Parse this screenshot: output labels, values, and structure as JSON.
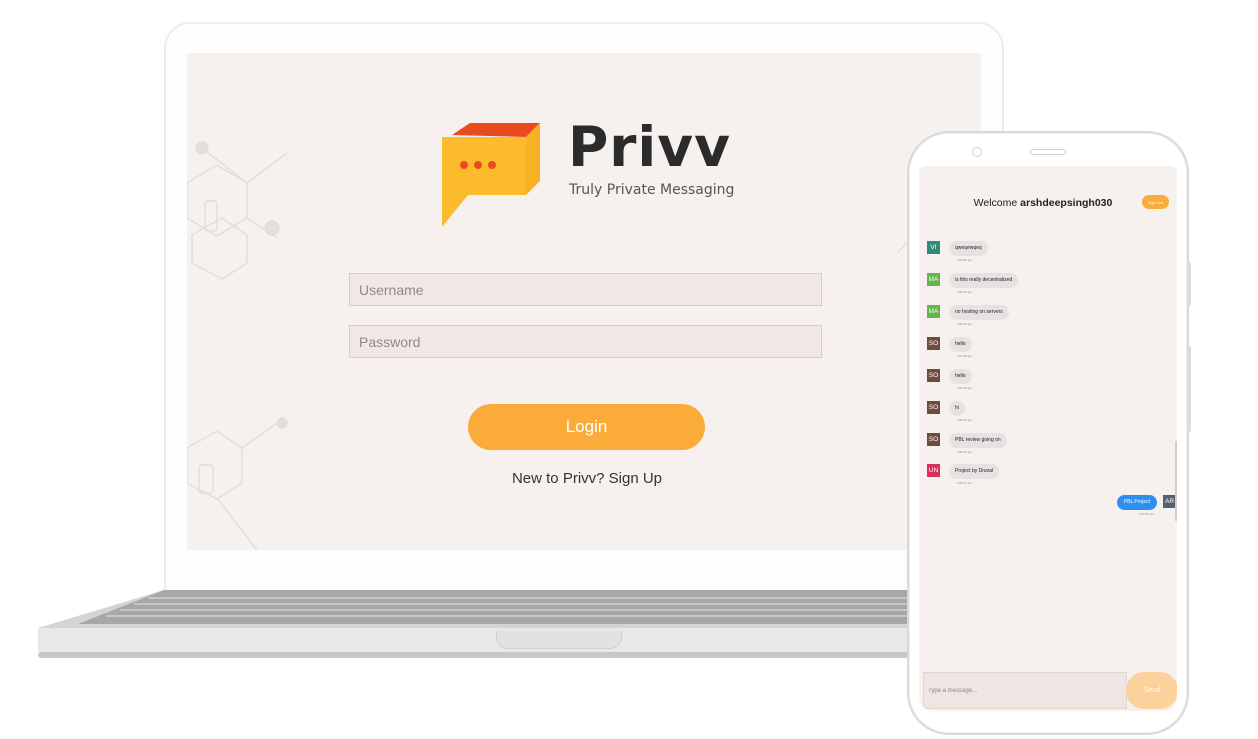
{
  "laptop": {
    "brand_name": "Privv",
    "tagline": "Truly Private Messaging",
    "username_placeholder": "Username",
    "password_placeholder": "Password",
    "login_label": "Login",
    "signup_text": "New to Privv? Sign Up"
  },
  "phone": {
    "welcome_prefix": "Welcome",
    "welcome_user": "arshdeepsingh030",
    "signout_label": "Sign Out",
    "messages": [
      {
        "avatar": "VI",
        "color": "#2e8b74",
        "text": "qweqewqeq",
        "time": "2:03:40 pm"
      },
      {
        "avatar": "MA",
        "color": "#67b34c",
        "text": "is this really decentralized",
        "time": "2:05:22 pm"
      },
      {
        "avatar": "MA",
        "color": "#67b34c",
        "text": "no hosting on servers",
        "time": "2:05:38 pm"
      },
      {
        "avatar": "SO",
        "color": "#6f4c3e",
        "text": "hello",
        "time": "2:07:38 pm"
      },
      {
        "avatar": "SO",
        "color": "#6f4c3e",
        "text": "hello",
        "time": "2:07:53 pm"
      },
      {
        "avatar": "SO",
        "color": "#6f4c3e",
        "text": "hi",
        "time": "2:08:03 pm"
      },
      {
        "avatar": "SO",
        "color": "#6f4c3e",
        "text": "PBL review going on",
        "time": "2:08:13 pm"
      },
      {
        "avatar": "UN",
        "color": "#d6305c",
        "text": "Project by Druval",
        "time": "2:09:37 pm"
      }
    ],
    "outgoing": {
      "avatar": "AR",
      "text": "PBL Project",
      "time": "4:02:31 pm"
    },
    "input_placeholder": "Type a message...",
    "send_label": "Send"
  },
  "colors": {
    "accent": "#fbab3a",
    "screen_bg": "#f6f1ee",
    "outgoing_bubble": "#2f8ff0"
  }
}
